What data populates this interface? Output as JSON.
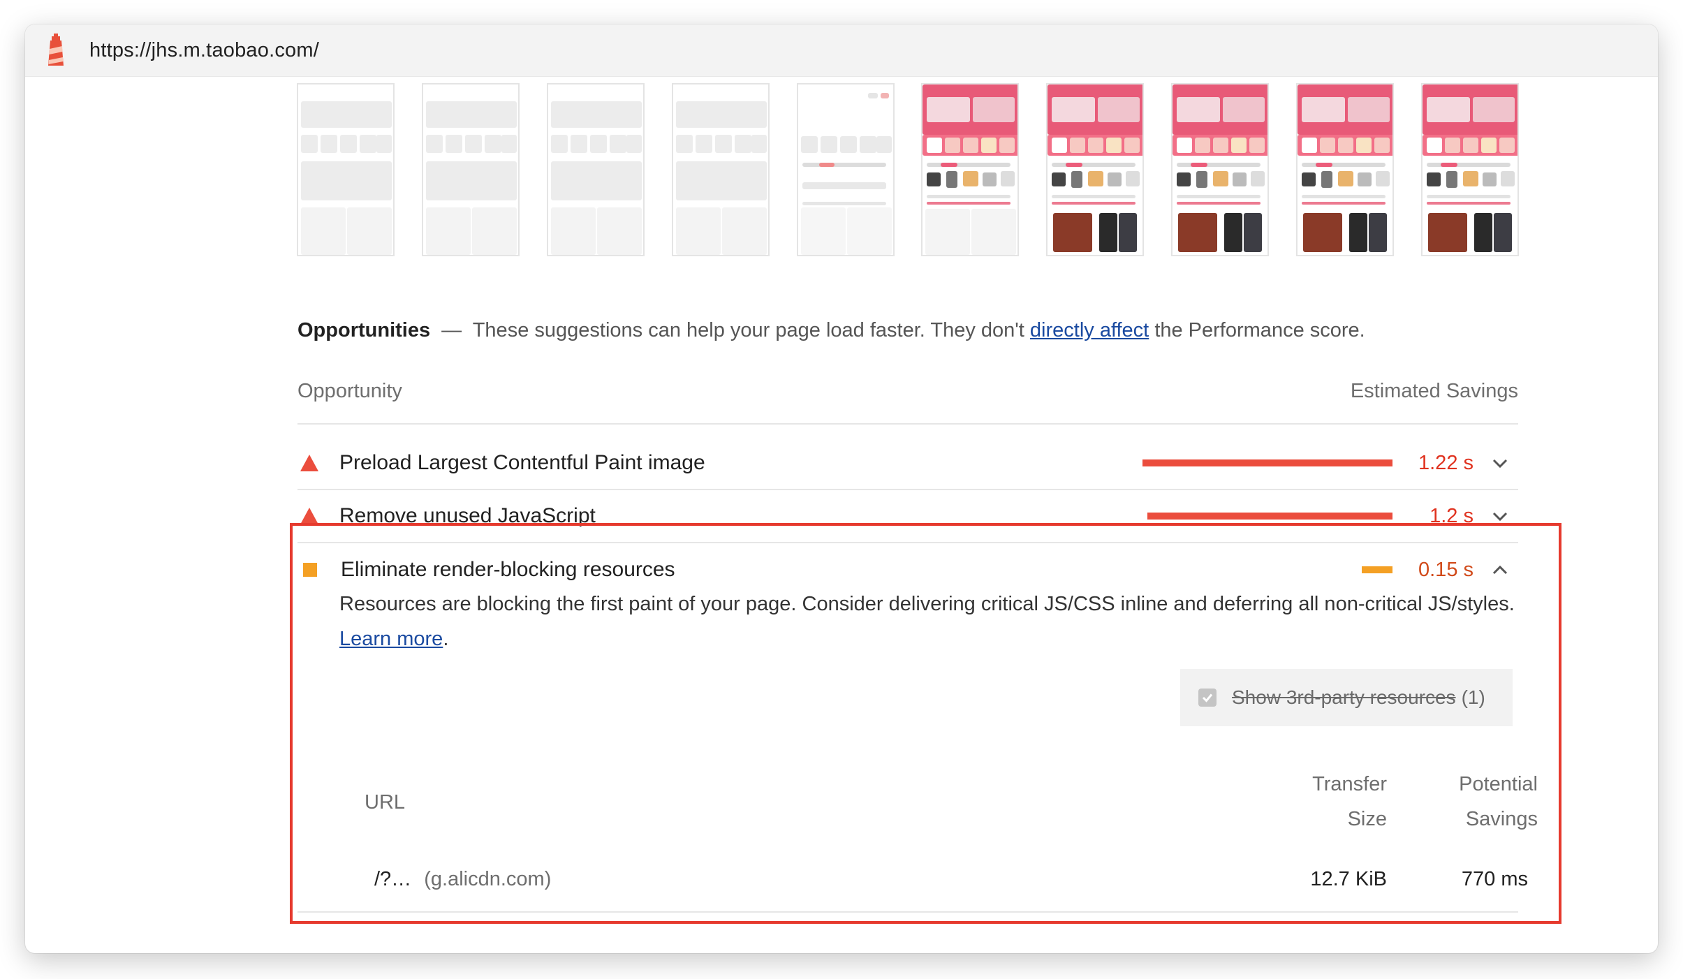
{
  "url": "https://jhs.m.taobao.com/",
  "filmstrip": {
    "frames": [
      "blank",
      "blank",
      "blank",
      "blank",
      "partial",
      "full",
      "full",
      "full",
      "full",
      "full"
    ]
  },
  "opportunities_header": {
    "title": "Opportunities",
    "dash": "—",
    "text_before": "These suggestions can help your page load faster. They don't",
    "link": "directly affect",
    "text_after": "the Performance score."
  },
  "columns": {
    "left": "Opportunity",
    "right": "Estimated Savings"
  },
  "audits": [
    {
      "title": "Preload Largest Contentful Paint image",
      "savings": "1.22 s",
      "severity": "fail",
      "bar_fraction": 1.0
    },
    {
      "title": "Remove unused JavaScript",
      "savings": "1.2 s",
      "severity": "fail",
      "bar_fraction": 0.98
    },
    {
      "title": "Eliminate render-blocking resources",
      "savings": "0.15 s",
      "severity": "average",
      "bar_fraction": 0.12
    }
  ],
  "details": {
    "description": "Resources are blocking the first paint of your page. Consider delivering critical JS/CSS inline and deferring all non-critical JS/styles.",
    "learn_more": "Learn more",
    "period": ".",
    "third_party_label": "Show 3rd-party resources",
    "third_party_count": "(1)",
    "table": {
      "col_url": "URL",
      "col_transfer_1": "Transfer",
      "col_transfer_2": "Size",
      "col_savings_1": "Potential",
      "col_savings_2": "Savings",
      "rows": [
        {
          "url": "/?…",
          "host": "(g.alicdn.com)",
          "transfer": "12.7 KiB",
          "savings": "770 ms"
        }
      ]
    }
  },
  "colors": {
    "fail": "#eb4d3d",
    "average": "#f4a024",
    "link": "#1a4aa0",
    "highlight_border": "#e63a2e"
  }
}
